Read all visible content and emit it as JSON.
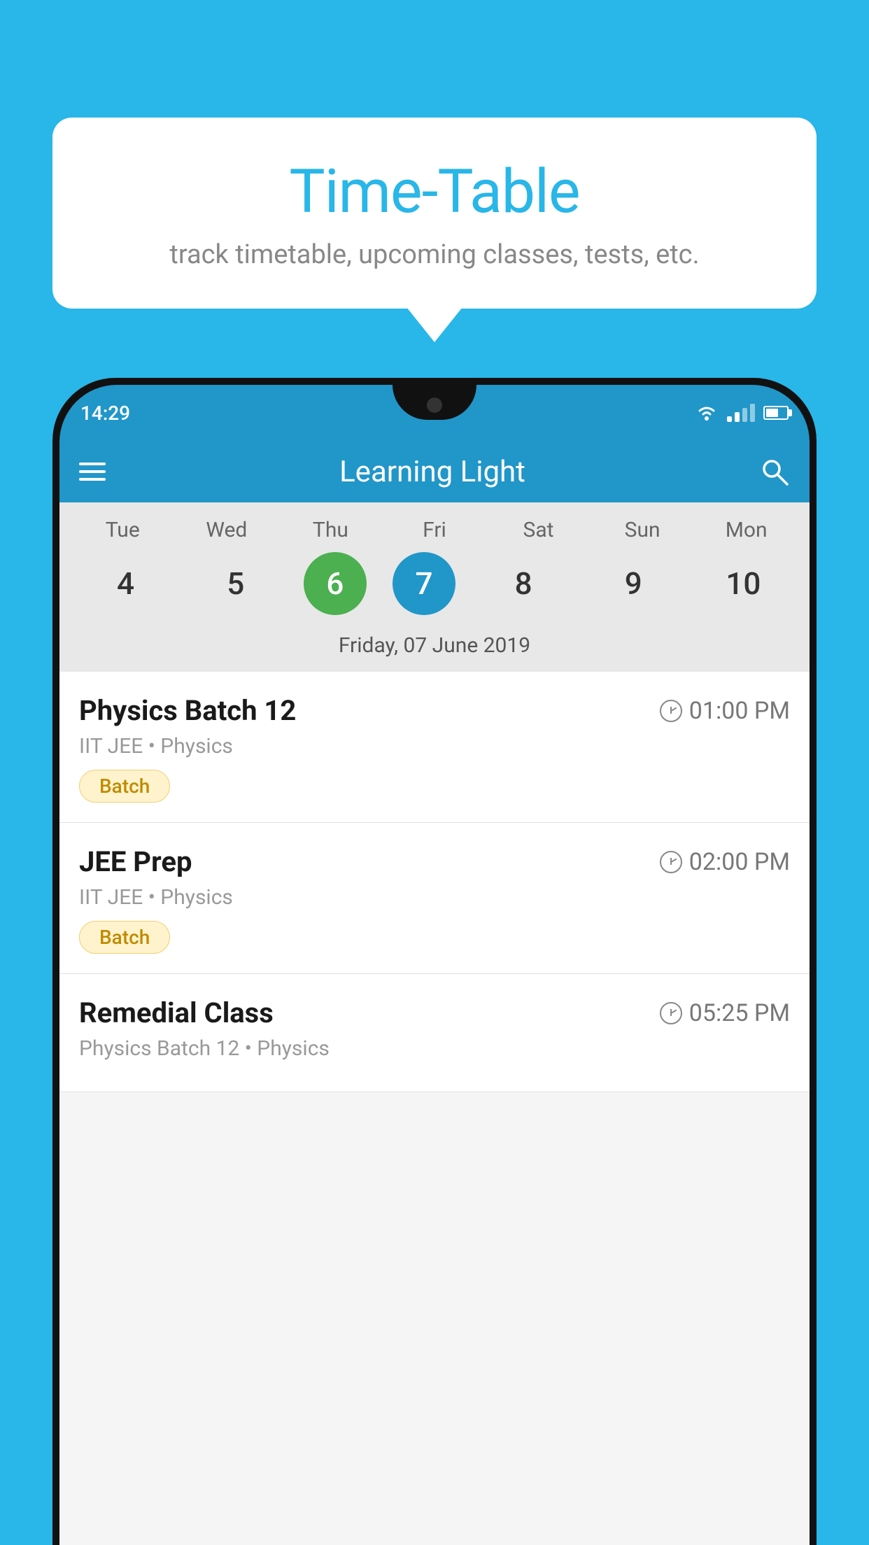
{
  "background": {
    "color": "#29B6E8"
  },
  "tooltip": {
    "title": "Time-Table",
    "subtitle": "track timetable, upcoming classes, tests, etc."
  },
  "phone": {
    "status_bar": {
      "time": "14:29"
    },
    "app_header": {
      "title": "Learning Light"
    },
    "calendar": {
      "days": [
        {
          "label": "Tue",
          "number": "4"
        },
        {
          "label": "Wed",
          "number": "5"
        },
        {
          "label": "Thu",
          "number": "6",
          "state": "today"
        },
        {
          "label": "Fri",
          "number": "7",
          "state": "selected"
        },
        {
          "label": "Sat",
          "number": "8"
        },
        {
          "label": "Sun",
          "number": "9"
        },
        {
          "label": "Mon",
          "number": "10"
        }
      ],
      "selected_date_label": "Friday, 07 June 2019"
    },
    "schedule": [
      {
        "title": "Physics Batch 12",
        "time": "01:00 PM",
        "sub": "IIT JEE • Physics",
        "badge": "Batch"
      },
      {
        "title": "JEE Prep",
        "time": "02:00 PM",
        "sub": "IIT JEE • Physics",
        "badge": "Batch"
      },
      {
        "title": "Remedial Class",
        "time": "05:25 PM",
        "sub": "Physics Batch 12 • Physics",
        "badge": null
      }
    ]
  },
  "icons": {
    "hamburger": "☰",
    "search": "search",
    "clock": "clock"
  }
}
